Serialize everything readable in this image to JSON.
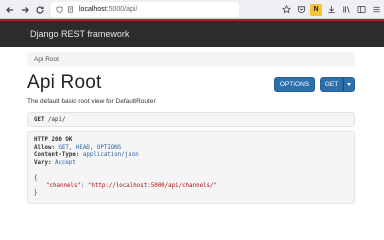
{
  "browser": {
    "url_host": "localhost",
    "url_path": ":5000/api/",
    "ext_badge": "N"
  },
  "navbar": {
    "brand": "Django REST framework"
  },
  "breadcrumb": {
    "item": "Api Root"
  },
  "page": {
    "title": "Api Root",
    "description": "The default basic root view for DefaultRouter",
    "options_label": "OPTIONS",
    "get_label": "GET"
  },
  "request": {
    "method": "GET",
    "path": "/api/"
  },
  "response": {
    "status": "HTTP 200 OK",
    "headers": [
      {
        "name": "Allow:",
        "value": "GET, HEAD, OPTIONS"
      },
      {
        "name": "Content-Type:",
        "value": "application/json"
      },
      {
        "name": "Vary:",
        "value": "Accept"
      }
    ],
    "body_open": "{",
    "body_key": "\"channels\"",
    "body_sep": ": ",
    "body_value": "\"http://localhost:5000/api/channels/\"",
    "body_close": "}"
  },
  "colors": {
    "navbar_bg": "#2c2c2c",
    "navbar_accent": "#a8242a",
    "button_primary": "#2c6fad"
  }
}
